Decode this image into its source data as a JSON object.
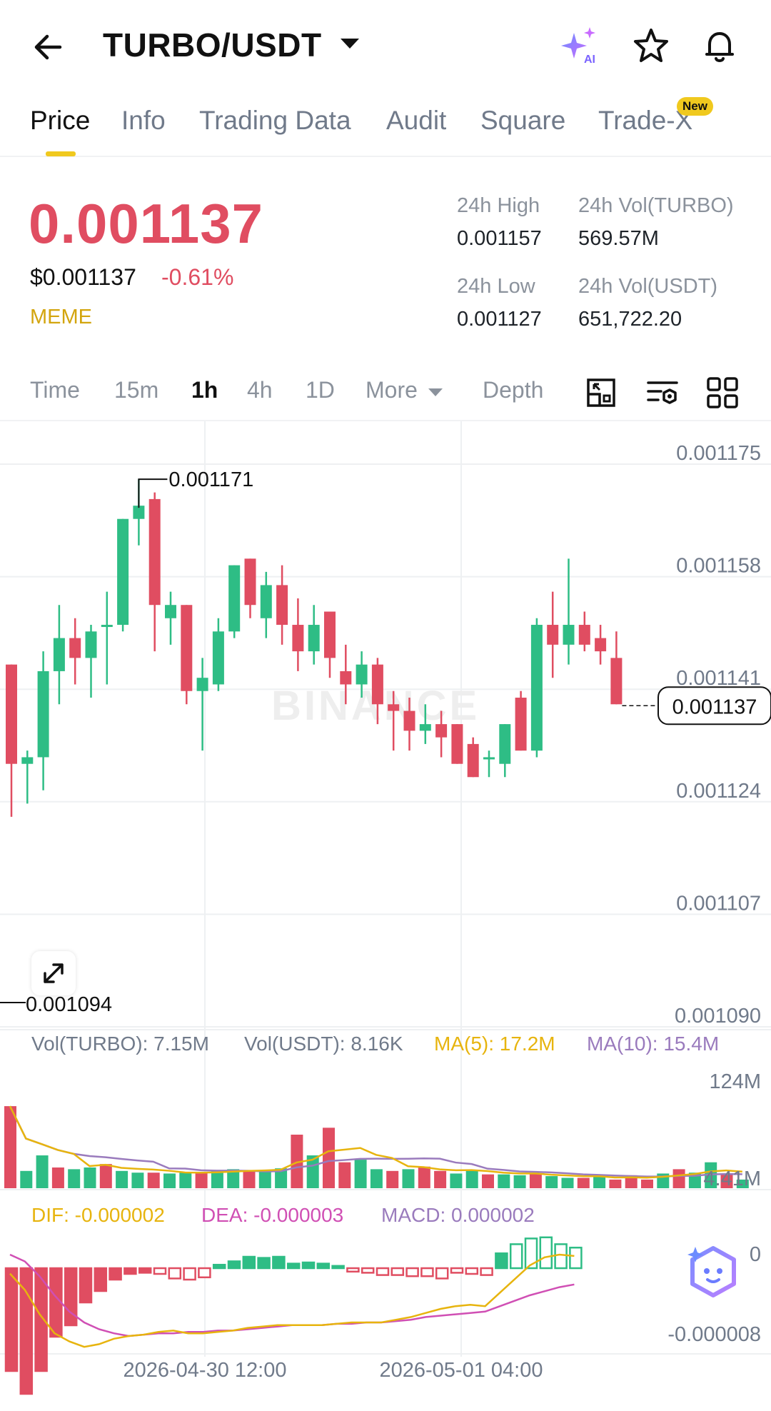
{
  "header": {
    "pair": "TURBO/USDT",
    "icons": {
      "back": "arrow-left-icon",
      "ai": "ai-sparkle-icon",
      "ai_label": "AI",
      "favorite": "star-icon",
      "alerts": "bell-icon"
    }
  },
  "tabs": [
    {
      "label": "Price",
      "active": true
    },
    {
      "label": "Info"
    },
    {
      "label": "Trading Data"
    },
    {
      "label": "Audit"
    },
    {
      "label": "Square"
    },
    {
      "label": "Trade-X",
      "badge": "New"
    }
  ],
  "price": {
    "last": "0.001137",
    "usd": "$0.001137",
    "change_pct": "-0.61%",
    "tag": "MEME",
    "high_label": "24h High",
    "high_value": "0.001157",
    "low_label": "24h Low",
    "low_value": "0.001127",
    "vol_base_label": "24h Vol(TURBO)",
    "vol_base_value": "569.57M",
    "vol_quote_label": "24h Vol(USDT)",
    "vol_quote_value": "651,722.20",
    "up_color": "#2ebd85",
    "down_color": "#e04d61"
  },
  "intervals": {
    "items": [
      "Time",
      "15m",
      "1h",
      "4h",
      "1D"
    ],
    "active": "1h",
    "more": "More",
    "depth": "Depth",
    "tool_icons": [
      "chart-settings-icon",
      "indicator-settings-icon",
      "grid-layout-icon"
    ]
  },
  "chart_data": [
    {
      "type": "candlestick",
      "interval": "1h",
      "price_axis_ticks": [
        "0.001175",
        "0.001158",
        "0.001141",
        "0.001124",
        "0.001107",
        "0.001090"
      ],
      "current_price_label": "0.001137",
      "high_marker": "0.001171",
      "low_marker": "0.001094",
      "watermark": "BINANCE",
      "time_labels": [
        "2026-04-30 12:00",
        "2026-05-01 04:00"
      ],
      "candles": [
        {
          "o": 0.001143,
          "h": 0.001143,
          "l": 0.00112,
          "c": 0.001128
        },
        {
          "o": 0.001128,
          "h": 0.00113,
          "l": 0.001122,
          "c": 0.001129
        },
        {
          "o": 0.001129,
          "h": 0.001145,
          "l": 0.001124,
          "c": 0.001142
        },
        {
          "o": 0.001142,
          "h": 0.001152,
          "l": 0.001137,
          "c": 0.001147
        },
        {
          "o": 0.001147,
          "h": 0.00115,
          "l": 0.00114,
          "c": 0.001144
        },
        {
          "o": 0.001144,
          "h": 0.001149,
          "l": 0.001138,
          "c": 0.001148
        },
        {
          "o": 0.001149,
          "h": 0.001154,
          "l": 0.00114,
          "c": 0.001149
        },
        {
          "o": 0.001149,
          "h": 0.001164,
          "l": 0.001148,
          "c": 0.001165
        },
        {
          "o": 0.001165,
          "h": 0.001171,
          "l": 0.001161,
          "c": 0.001167
        },
        {
          "o": 0.001168,
          "h": 0.001169,
          "l": 0.001145,
          "c": 0.001152
        },
        {
          "o": 0.00115,
          "h": 0.001154,
          "l": 0.001146,
          "c": 0.001152
        },
        {
          "o": 0.001152,
          "h": 0.001152,
          "l": 0.001137,
          "c": 0.001139
        },
        {
          "o": 0.001139,
          "h": 0.001144,
          "l": 0.00113,
          "c": 0.001141
        },
        {
          "o": 0.00114,
          "h": 0.00115,
          "l": 0.001139,
          "c": 0.001148
        },
        {
          "o": 0.001148,
          "h": 0.001158,
          "l": 0.001147,
          "c": 0.001158
        },
        {
          "o": 0.001159,
          "h": 0.001159,
          "l": 0.00115,
          "c": 0.001152
        },
        {
          "o": 0.00115,
          "h": 0.001157,
          "l": 0.001147,
          "c": 0.001155
        },
        {
          "o": 0.001155,
          "h": 0.001158,
          "l": 0.001146,
          "c": 0.001149
        },
        {
          "o": 0.001149,
          "h": 0.001153,
          "l": 0.001142,
          "c": 0.001145
        },
        {
          "o": 0.001145,
          "h": 0.001152,
          "l": 0.001143,
          "c": 0.001149
        },
        {
          "o": 0.001151,
          "h": 0.00115,
          "l": 0.001141,
          "c": 0.001144
        },
        {
          "o": 0.001142,
          "h": 0.001146,
          "l": 0.001137,
          "c": 0.00114
        },
        {
          "o": 0.00114,
          "h": 0.001145,
          "l": 0.001138,
          "c": 0.001143
        },
        {
          "o": 0.001143,
          "h": 0.001144,
          "l": 0.001134,
          "c": 0.001137
        },
        {
          "o": 0.001137,
          "h": 0.001139,
          "l": 0.00113,
          "c": 0.001136
        },
        {
          "o": 0.001136,
          "h": 0.001138,
          "l": 0.00113,
          "c": 0.001133
        },
        {
          "o": 0.001133,
          "h": 0.001137,
          "l": 0.001131,
          "c": 0.001134
        },
        {
          "o": 0.001134,
          "h": 0.001136,
          "l": 0.001129,
          "c": 0.001132
        },
        {
          "o": 0.001134,
          "h": 0.001133,
          "l": 0.00113,
          "c": 0.001128
        },
        {
          "o": 0.001131,
          "h": 0.001132,
          "l": 0.001128,
          "c": 0.001126
        },
        {
          "o": 0.001129,
          "h": 0.00113,
          "l": 0.001126,
          "c": 0.001129
        },
        {
          "o": 0.001128,
          "h": 0.001131,
          "l": 0.001126,
          "c": 0.001134
        },
        {
          "o": 0.001138,
          "h": 0.001139,
          "l": 0.00113,
          "c": 0.00113
        },
        {
          "o": 0.00113,
          "h": 0.00115,
          "l": 0.001129,
          "c": 0.001149
        },
        {
          "o": 0.001149,
          "h": 0.001154,
          "l": 0.001141,
          "c": 0.001146
        },
        {
          "o": 0.001146,
          "h": 0.001159,
          "l": 0.001143,
          "c": 0.001149
        },
        {
          "o": 0.001149,
          "h": 0.001151,
          "l": 0.001145,
          "c": 0.001146
        },
        {
          "o": 0.001147,
          "h": 0.001149,
          "l": 0.001143,
          "c": 0.001145
        },
        {
          "o": 0.001144,
          "h": 0.001148,
          "l": 0.001137,
          "c": 0.001137
        }
      ]
    },
    {
      "type": "bar",
      "name": "volume",
      "legend": {
        "vol_base": "Vol(TURBO): 7.15M",
        "vol_quote": "Vol(USDT): 8.16K",
        "ma5": "MA(5): 17.2M",
        "ma10": "MA(10): 15.4M"
      },
      "axis_ticks": [
        "124M",
        "4.41M"
      ],
      "ma5_color": "#e7b40e",
      "ma10_color": "#9a7bbd",
      "values": [
        95,
        20,
        38,
        24,
        22,
        24,
        28,
        20,
        18,
        18,
        17,
        18,
        19,
        20,
        22,
        21,
        21,
        23,
        62,
        38,
        70,
        30,
        33,
        22,
        20,
        22,
        25,
        20,
        17,
        21,
        16,
        16,
        15,
        17,
        14,
        12,
        12,
        14,
        10,
        15,
        10,
        17,
        22,
        18,
        30,
        16,
        10
      ]
    },
    {
      "type": "bar",
      "name": "macd",
      "legend": {
        "dif": "DIF: -0.000002",
        "dea": "DEA: -0.000003",
        "macd": "MACD: 0.000002"
      },
      "axis_ticks": [
        "0",
        "-0.000008"
      ],
      "dif_color": "#e7b40e",
      "dea_color": "#d04fb4",
      "histogram": [
        -9,
        -11,
        -9,
        -6,
        -5,
        -3,
        -2,
        -1,
        -0.5,
        -0.4,
        -0.5,
        -0.9,
        -1.0,
        -0.8,
        0.3,
        0.6,
        1.0,
        0.9,
        1.0,
        0.4,
        0.5,
        0.4,
        0.2,
        -0.3,
        -0.4,
        -0.6,
        -0.6,
        -0.7,
        -0.7,
        -0.9,
        -0.4,
        -0.5,
        -0.6,
        1.3,
        2.1,
        2.6,
        2.7,
        2.1,
        1.8
      ]
    }
  ]
}
